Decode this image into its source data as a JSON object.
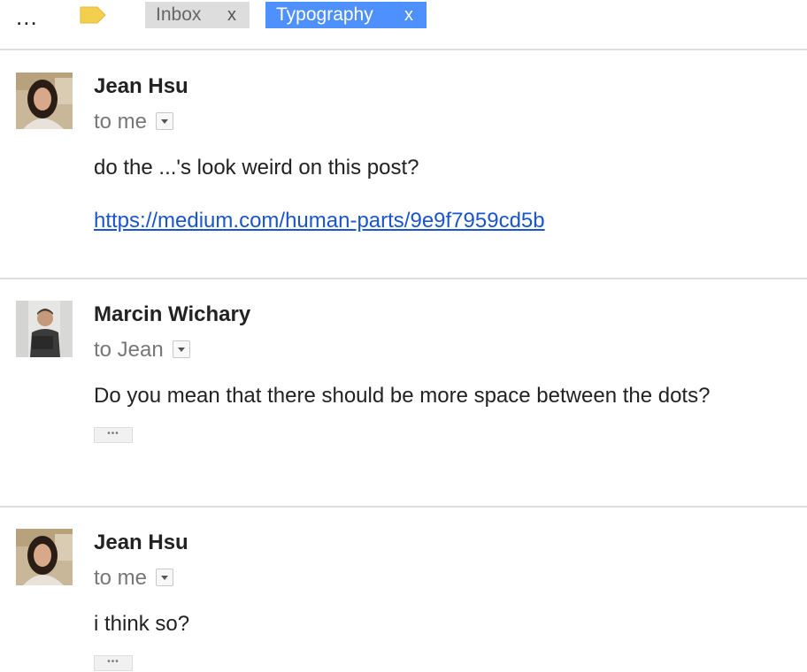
{
  "toolbar": {
    "more_label": "...",
    "label_icon": "label-tag-icon",
    "label_color": "#f4cf4d"
  },
  "chips": [
    {
      "label": "Inbox",
      "close": "x",
      "bg": "#dddddd"
    },
    {
      "label": "Typography",
      "close": "x",
      "bg": "#4d90fe"
    }
  ],
  "messages": [
    {
      "sender": "Jean Hsu",
      "recipient": "to me",
      "body": "do the ...'s look weird on this post?",
      "link": "https://medium.com/human-parts/9e9f7959cd5b"
    },
    {
      "sender": "Marcin Wichary",
      "recipient": "to Jean",
      "body": "Do you mean that there should be more space between the dots?",
      "quote_toggle": "•••"
    },
    {
      "sender": "Jean Hsu",
      "recipient": "to me",
      "body": "i think so?",
      "quote_toggle": "•••"
    }
  ]
}
